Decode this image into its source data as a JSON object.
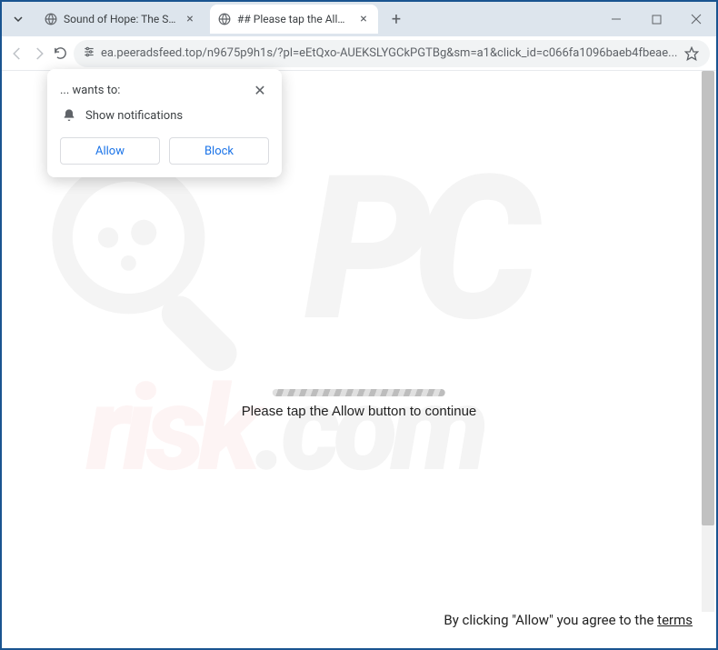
{
  "tabs": [
    {
      "title": "Sound of Hope: The Story of Po"
    },
    {
      "title": "## Please tap the Allow button"
    }
  ],
  "url": "ea.peeradsfeed.top/n9675p9h1s/?pl=eEtQxo-AUEKSLYGCkPGTBg&sm=a1&click_id=c066fa1096baeb4fbeae...",
  "dialog": {
    "wants_to": "... wants to:",
    "permission": "Show notifications",
    "allow_label": "Allow",
    "block_label": "Block"
  },
  "page": {
    "progress_text": "Please tap the Allow button to continue",
    "footer_prefix": "By clicking \"Allow\" you agree to the ",
    "footer_terms": "terms"
  }
}
